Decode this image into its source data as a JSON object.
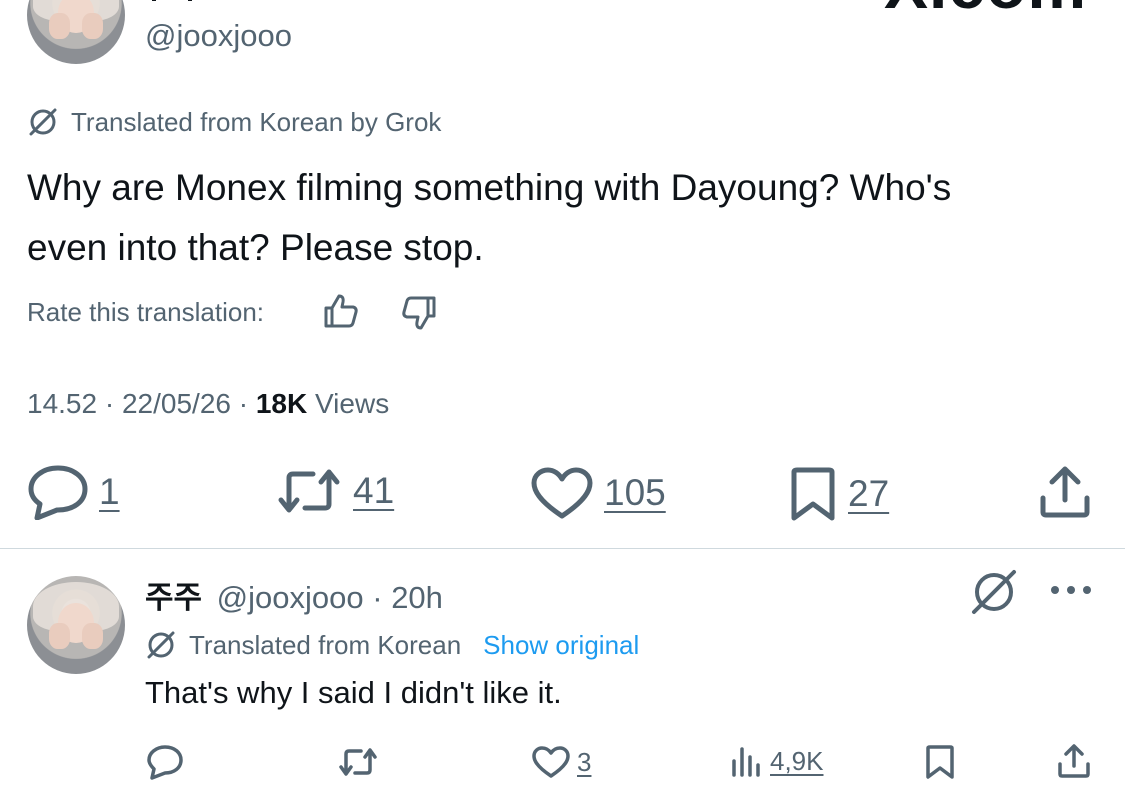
{
  "brand": {
    "watermark": "X.com"
  },
  "main_tweet": {
    "handle": "@jooxjooo",
    "translation_note": "Translated from Korean by Grok",
    "text_line1": "Why are Monex filming something with Dayoung? Who's",
    "text_line2": "even into that? Please stop.",
    "rate_label": "Rate this translation:",
    "time": "14.52",
    "date": "22/05/26",
    "views_count": "18K",
    "views_label": "Views",
    "actions": {
      "replies": "1",
      "reposts": "41",
      "likes": "105",
      "bookmarks": "27"
    }
  },
  "reply_tweet": {
    "display_name": "주주",
    "handle": "@jooxjooo",
    "age": "20h",
    "translation_note": "Translated from Korean",
    "show_original": "Show original",
    "text": "That's why I said I didn't like it.",
    "actions": {
      "likes": "3",
      "views": "4,9K"
    }
  },
  "colors": {
    "text": "#0f1419",
    "muted": "#536471",
    "link": "#1d9bf0",
    "divider": "#cfd9de"
  },
  "icons": [
    "grok-icon",
    "thumbs-up-icon",
    "thumbs-down-icon",
    "reply-icon",
    "repost-icon",
    "like-icon",
    "bookmark-icon",
    "share-icon",
    "views-icon",
    "more-icon"
  ]
}
